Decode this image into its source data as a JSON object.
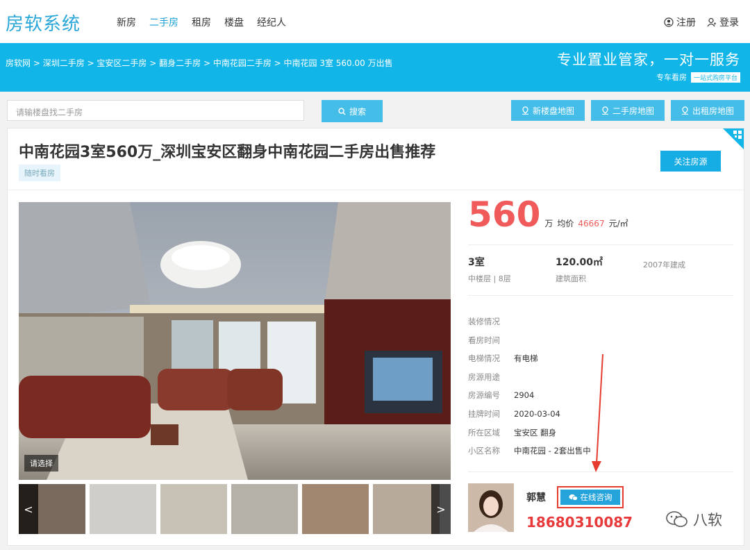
{
  "header": {
    "logo": "房软系统",
    "nav": [
      "新房",
      "二手房",
      "租房",
      "楼盘",
      "经纪人"
    ],
    "active_nav": "二手房",
    "register": "注册",
    "login": "登录"
  },
  "banner": {
    "breadcrumb": [
      "房软网",
      "深圳二手房",
      "宝安区二手房",
      "翻身二手房",
      "中南花园二手房",
      "中南花园 3室 560.00 万出售"
    ],
    "slogan": "专业置业管家，一对一服务",
    "sub_slogan": "专车看房",
    "sub_tag": "一站式购房平台"
  },
  "search": {
    "placeholder": "请输楼盘找二手房",
    "button": "搜索",
    "map_buttons": [
      "新楼盘地图",
      "二手房地图",
      "出租房地图"
    ]
  },
  "listing": {
    "title": "中南花园3室560万_深圳宝安区翻身中南花园二手房出售推荐",
    "badge": "随时看房",
    "follow_button": "关注房源",
    "photo_choose": "请选择",
    "price": "560",
    "price_unit": "万",
    "avg_label": "均价",
    "avg_price": "46667",
    "avg_unit": "元/㎡",
    "specs": [
      {
        "value": "3室",
        "label": "中楼层 | 8层"
      },
      {
        "value": "120.00㎡",
        "label": "建筑面积"
      },
      {
        "value": "",
        "label": "2007年建成"
      }
    ],
    "details": [
      {
        "key": "装修情况",
        "value": ""
      },
      {
        "key": "看房时间",
        "value": ""
      },
      {
        "key": "电梯情况",
        "value": "有电梯"
      },
      {
        "key": "房源用途",
        "value": ""
      },
      {
        "key": "房源编号",
        "value": "2904"
      },
      {
        "key": "挂牌时间",
        "value": "2020-03-04"
      },
      {
        "key": "所在区域",
        "value": "宝安区 翻身"
      },
      {
        "key": "小区名称",
        "value": "中南花园 - 2套出售中"
      }
    ]
  },
  "agent": {
    "name": "郭慧",
    "consult_button": "在线咨询",
    "phone": "18680310087"
  },
  "watermark": "八软",
  "colors": {
    "brand": "#12b5e8",
    "price": "#f05a5a",
    "highlight_box": "#e53c2f"
  }
}
